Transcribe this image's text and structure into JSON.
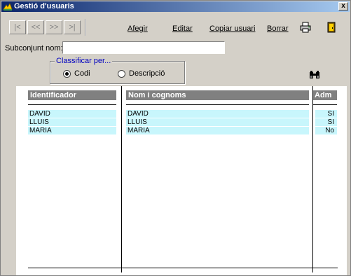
{
  "window": {
    "title": "Gestió d'usuaris",
    "close_label": "x"
  },
  "toolbar": {
    "nav": [
      "|<",
      "<<",
      ">>",
      ">|"
    ],
    "add_label": "Afegir",
    "edit_label": "Editar",
    "copy_label": "Copiar usuari",
    "delete_label": "Borrar",
    "print_icon": "printer-icon",
    "exit_icon": "exit-door-icon"
  },
  "filter": {
    "label": "Subconjunt nom:",
    "value": ""
  },
  "sort": {
    "legend": "Classificar per...",
    "options": [
      "Codi",
      "Descripció"
    ],
    "selected": "Codi"
  },
  "search_icon": "binoculars-icon",
  "table": {
    "columns": [
      "Identificador",
      "Nom i cognoms",
      "Adm"
    ],
    "rows": [
      [
        "DAVID",
        "DAVID",
        "SI"
      ],
      [
        "LLUIS",
        "LLUIS",
        "SI"
      ],
      [
        "MARIA",
        "MARIA",
        "No"
      ]
    ]
  },
  "colors": {
    "title_start": "#0a246a",
    "title_end": "#a6caf0",
    "cell_bg": "#c8f6fc",
    "header_bg": "#808080",
    "legend": "#0000c0"
  }
}
